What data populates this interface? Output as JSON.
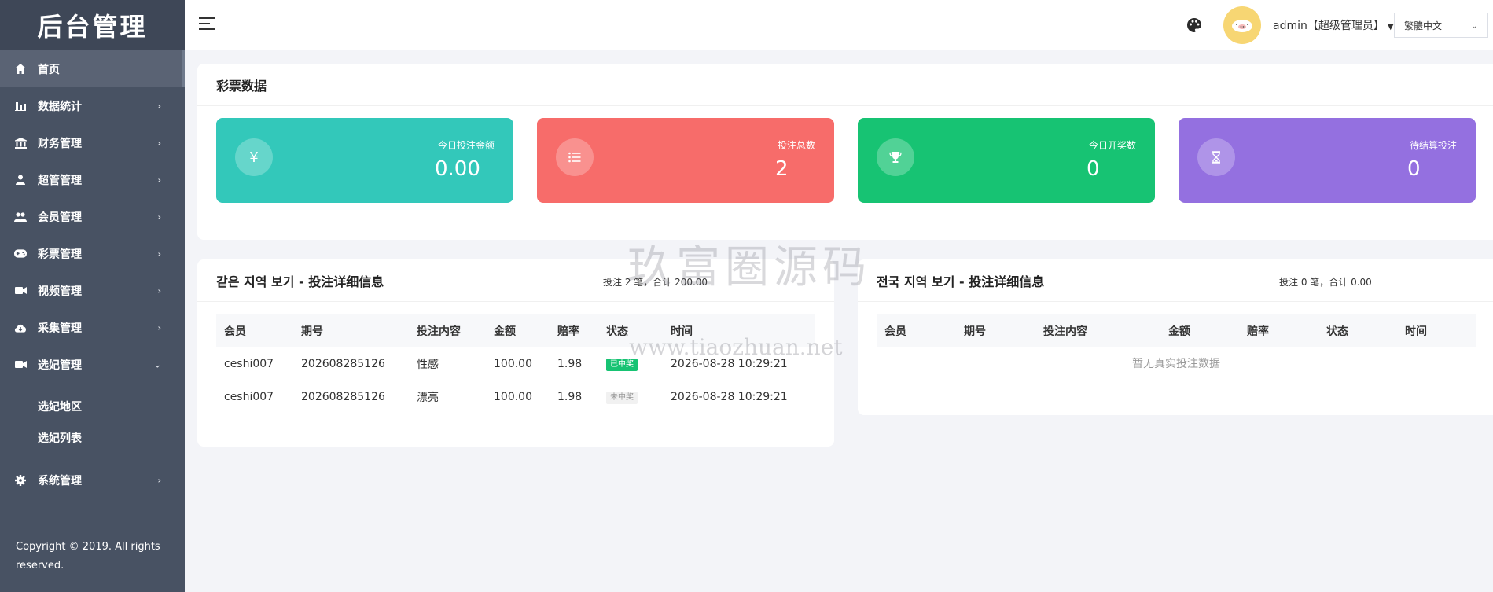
{
  "sidebar": {
    "brand": "后台管理",
    "items": [
      {
        "label": "首页"
      },
      {
        "label": "数据统计"
      },
      {
        "label": "财务管理"
      },
      {
        "label": "超管管理"
      },
      {
        "label": "会员管理"
      },
      {
        "label": "彩票管理"
      },
      {
        "label": "视频管理"
      },
      {
        "label": "采集管理"
      },
      {
        "label": "选妃管理"
      },
      {
        "label": "系统管理"
      }
    ],
    "sub_items": [
      {
        "label": "选妃地区"
      },
      {
        "label": "选妃列表"
      }
    ],
    "copyright": "Copyright © 2019. All rights reserved."
  },
  "header": {
    "user": "admin【超级管理员】",
    "language": "繁體中文"
  },
  "lottery_panel": {
    "title": "彩票数据",
    "stats": [
      {
        "label": "今日投注金额",
        "value": "0.00",
        "icon": "yen-icon",
        "color": "#33c8ba"
      },
      {
        "label": "投注总数",
        "value": "2",
        "icon": "list-icon",
        "color": "#f76c6a"
      },
      {
        "label": "今日开奖数",
        "value": "0",
        "icon": "trophy-icon",
        "color": "#17c373"
      },
      {
        "label": "待结算投注",
        "value": "0",
        "icon": "hourglass-icon",
        "color": "#9470e0"
      }
    ]
  },
  "local_bets": {
    "title": "같은 지역 보기 - 投注详细信息",
    "summary": "投注 2 笔，合计 200.00",
    "columns": [
      "会员",
      "期号",
      "投注内容",
      "金额",
      "赔率",
      "状态",
      "时间"
    ],
    "rows": [
      {
        "member": "ceshi007",
        "period": "202608285126",
        "content": "性感",
        "amount": "100.00",
        "odds": "1.98",
        "status": "已中奖",
        "time": "2026-08-28 10:29:21"
      },
      {
        "member": "ceshi007",
        "period": "202608285126",
        "content": "漂亮",
        "amount": "100.00",
        "odds": "1.98",
        "status": "未中奖",
        "time": "2026-08-28 10:29:21"
      }
    ]
  },
  "national_bets": {
    "title": "전국 지역 보기 - 投注详细信息",
    "summary": "投注 0 笔，合计 0.00",
    "columns": [
      "会员",
      "期号",
      "投注内容",
      "金额",
      "赔率",
      "状态",
      "时间"
    ],
    "empty": "暂无真实投注数据"
  },
  "watermark": {
    "title": "玖富圈源码",
    "url": "www.tiaozhuan.net"
  },
  "colors": {
    "sidebar": "#485263",
    "won": "#17c373",
    "lost_text": "#999999"
  }
}
